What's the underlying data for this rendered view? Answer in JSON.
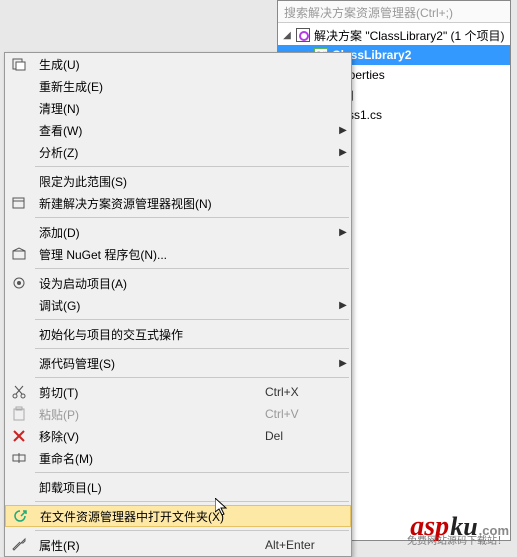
{
  "solution": {
    "search_placeholder": "搜索解决方案资源管理器(Ctrl+;)",
    "root_label": "解决方案 \"ClassLibrary2\" (1 个项目)",
    "project_label": "ClassLibrary2",
    "nodes": {
      "properties": "Properties",
      "references": "引用",
      "class1": "Class1.cs"
    }
  },
  "menu": {
    "build": "生成(U)",
    "rebuild": "重新生成(E)",
    "clean": "清理(N)",
    "view": "查看(W)",
    "analyze": "分析(Z)",
    "scope": "限定为此范围(S)",
    "new_explorer": "新建解决方案资源管理器视图(N)",
    "add": "添加(D)",
    "nuget": "管理 NuGet 程序包(N)...",
    "startup": "设为启动项目(A)",
    "debug": "调试(G)",
    "interactive": "初始化与项目的交互式操作",
    "scc": "源代码管理(S)",
    "cut": "剪切(T)",
    "paste": "粘贴(P)",
    "remove": "移除(V)",
    "rename": "重命名(M)",
    "unload": "卸载项目(L)",
    "open_folder": "在文件资源管理器中打开文件夹(X)",
    "properties": "属性(R)"
  },
  "shortcut": {
    "cut": "Ctrl+X",
    "paste": "Ctrl+V",
    "remove": "Del",
    "properties": "Alt+Enter"
  },
  "logo": {
    "a": "asp",
    "k": "ku",
    "c": ".com",
    "sub": "免费网站源码下载站！"
  }
}
